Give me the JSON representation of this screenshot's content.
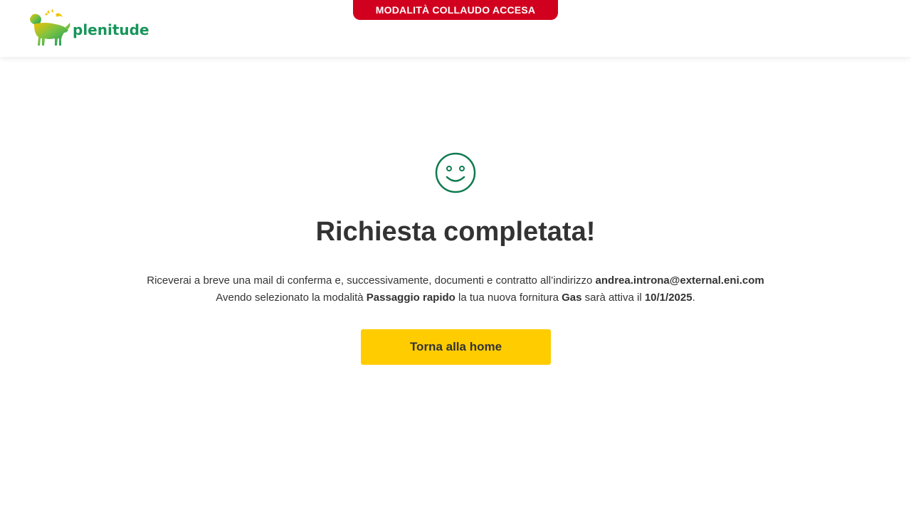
{
  "header": {
    "logo_text": "plenitude",
    "test_mode_banner": "MODALITÀ COLLAUDO ACCESA"
  },
  "main": {
    "icon": "smiley-icon",
    "title": "Richiesta completata!",
    "line1": {
      "prefix": "Riceverai a breve una mail di conferma e, successivamente, documenti e contratto all’indirizzo ",
      "email": "andrea.introna@external.eni.com"
    },
    "line2": {
      "part1": "Avendo selezionato la modalità ",
      "mode": "Passaggio rapido",
      "part2": " la tua nuova fornitura ",
      "supply": "Gas",
      "part3": " sarà attiva il ",
      "date": "10/1/2025",
      "part4": "."
    },
    "home_button_label": "Torna alla home"
  },
  "colors": {
    "brand_green": "#17955b",
    "banner_red": "#d1001f",
    "button_yellow": "#ffcc00",
    "text_dark": "#333333"
  }
}
